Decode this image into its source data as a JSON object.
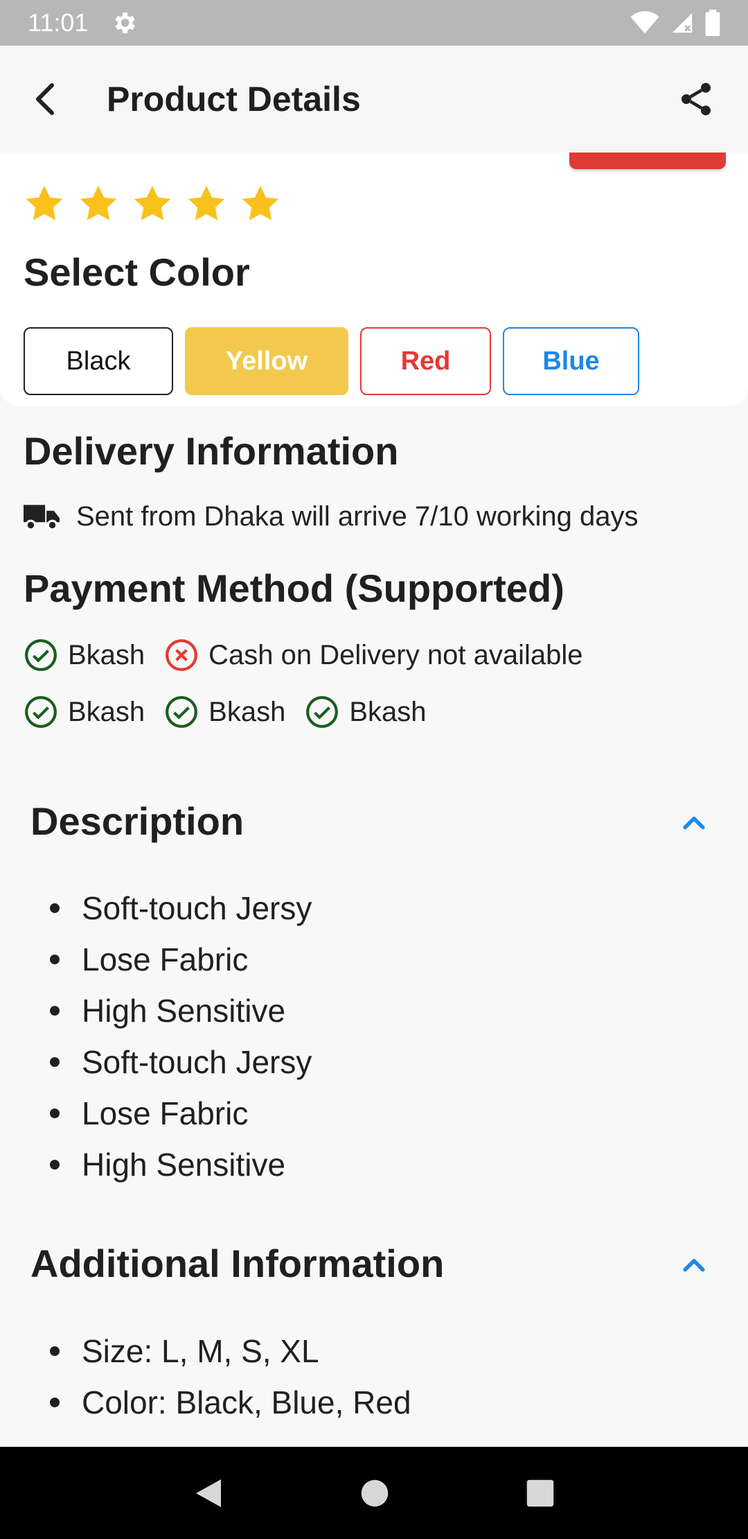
{
  "status_bar": {
    "time": "11:01"
  },
  "app_bar": {
    "title": "Product Details"
  },
  "rating": {
    "stars": 5,
    "star_color": "#F9C11B"
  },
  "select_color": {
    "heading": "Select Color",
    "options": [
      "Black",
      "Yellow",
      "Red",
      "Blue"
    ],
    "selected": "Yellow"
  },
  "delivery": {
    "heading": "Delivery Information",
    "text": "Sent from Dhaka will arrive 7/10 working days"
  },
  "payment": {
    "heading": "Payment Method (Supported)",
    "row1": [
      {
        "label": "Bkash",
        "supported": true
      },
      {
        "label": "Cash on Delivery not available",
        "supported": false
      }
    ],
    "row2": [
      {
        "label": "Bkash",
        "supported": true
      },
      {
        "label": "Bkash",
        "supported": true
      },
      {
        "label": "Bkash",
        "supported": true
      }
    ]
  },
  "description": {
    "heading": "Description",
    "items": [
      "Soft-touch Jersy",
      "Lose Fabric",
      "High Sensitive",
      "Soft-touch Jersy",
      "Lose Fabric",
      "High Sensitive"
    ]
  },
  "additional": {
    "heading": "Additional Information",
    "items": [
      "Size: L, M, S, XL",
      "Color: Black, Blue, Red"
    ]
  },
  "colors": {
    "accent_blue": "#1E88E5",
    "accent_red": "#E53935",
    "accent_yellow": "#F2C94C",
    "success_green": "#1B5E20"
  }
}
